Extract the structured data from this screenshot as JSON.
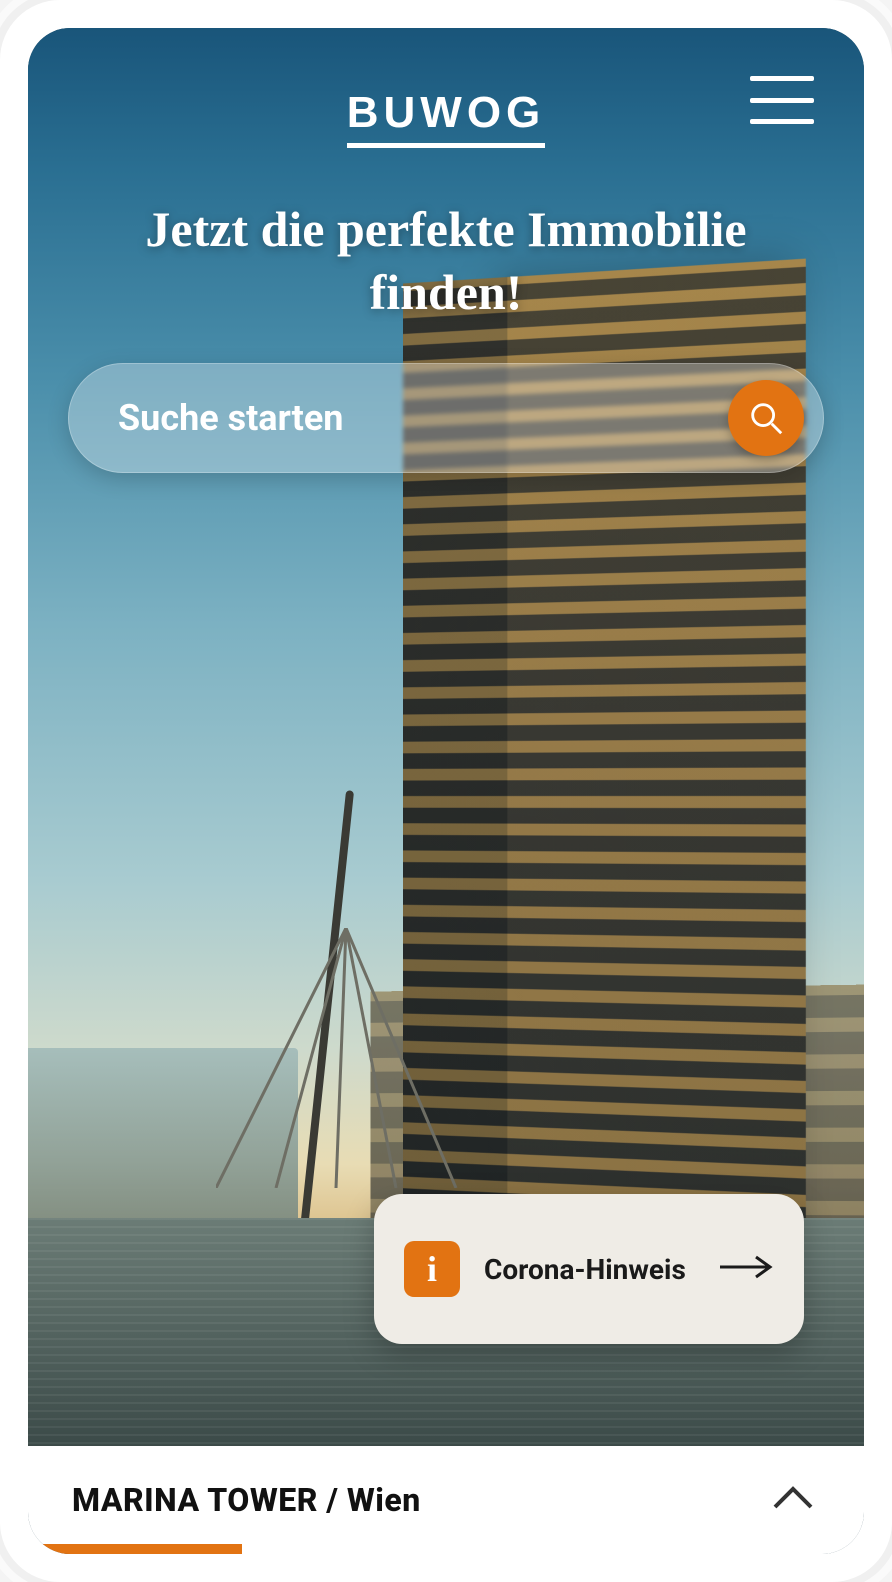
{
  "brand": {
    "logo_text": "BUWOG"
  },
  "hero": {
    "headline": "Jetzt die perfekte Immobilie finden!"
  },
  "search": {
    "label": "Suche starten",
    "icon_name": "search"
  },
  "notice": {
    "icon_name": "info",
    "label": "Corona-Hinweis"
  },
  "bottom": {
    "title": "MARINA TOWER / Wien"
  },
  "colors": {
    "accent": "#e27312"
  }
}
